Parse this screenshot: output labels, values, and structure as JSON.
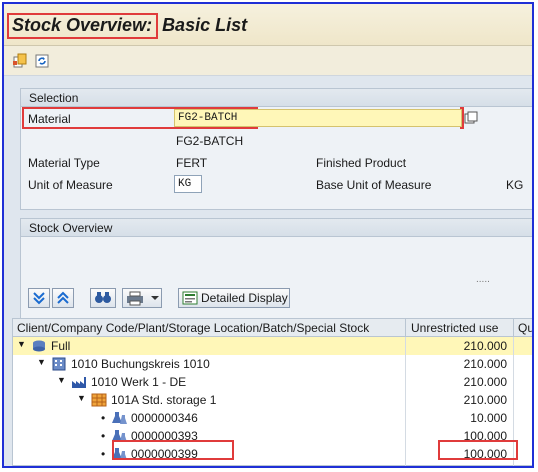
{
  "title": {
    "highlight": "Stock Overview:",
    "rest": "Basic List"
  },
  "toolbar": {
    "icons": [
      "new-document-icon",
      "refresh-icon"
    ]
  },
  "selection": {
    "header": "Selection",
    "material_label": "Material",
    "material_value": "FG2-BATCH",
    "material_desc": "FG2-BATCH",
    "material_type_label": "Material Type",
    "material_type_value": "FERT",
    "material_type_desc": "Finished Product",
    "uom_label": "Unit of Measure",
    "uom_value": "KG",
    "base_uom_label": "Base Unit of Measure",
    "base_uom_value": "KG"
  },
  "overview": {
    "header": "Stock Overview",
    "dots": ".....",
    "detailed_display": "Detailed Display"
  },
  "grid": {
    "col1": "Client/Company Code/Plant/Storage Location/Batch/Special Stock",
    "col2": "Unrestricted use",
    "col3": "Qu",
    "rows": [
      {
        "label": "Full",
        "value": "210.000"
      },
      {
        "label": "1010 Buchungskreis 1010",
        "value": "210.000"
      },
      {
        "label": "1010 Werk 1 - DE",
        "value": "210.000"
      },
      {
        "label": "101A Std. storage 1",
        "value": "210.000"
      },
      {
        "label": "0000000346",
        "value": "10.000"
      },
      {
        "label": "0000000393",
        "value": "100.000"
      },
      {
        "label": "0000000399",
        "value": "100.000"
      }
    ]
  },
  "colors": {
    "accent_red": "#e03b3b",
    "frame_blue": "#1f2fd6",
    "highlight_row": "#fff7b8"
  }
}
